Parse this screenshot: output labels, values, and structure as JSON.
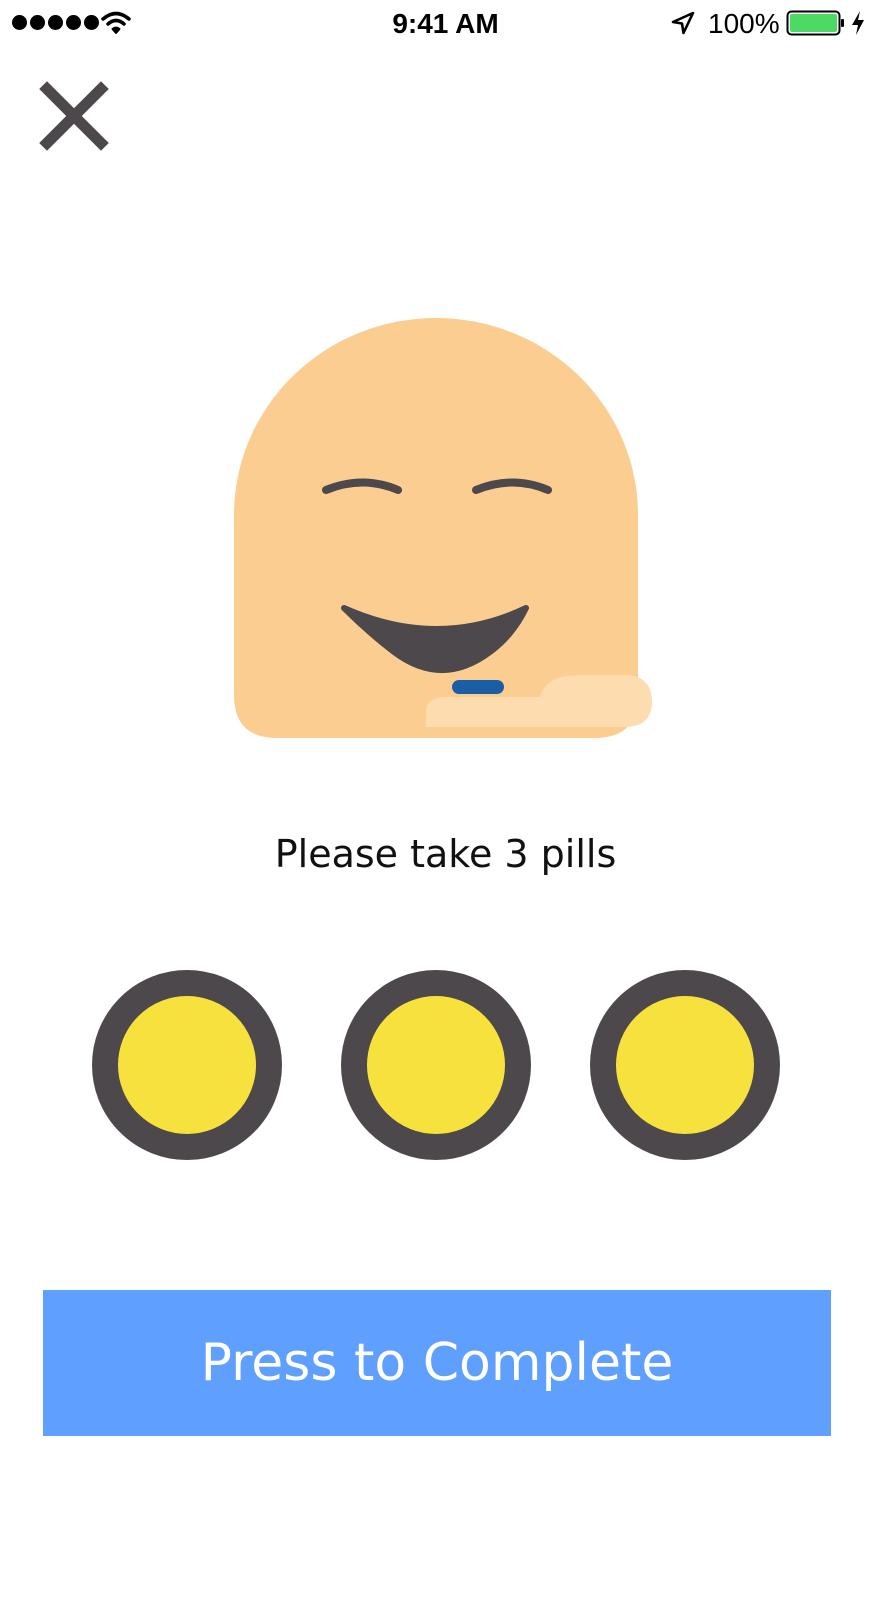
{
  "status_bar": {
    "time": "9:41 AM",
    "battery_percent": "100%",
    "signal_bars": 5,
    "icons": [
      "signal-dots",
      "wifi-icon",
      "location-arrow-icon",
      "battery-icon",
      "charging-bolt-icon"
    ]
  },
  "close": {
    "icon": "close-icon"
  },
  "illustration": {
    "icon": "smiling-face-with-pill-icon",
    "colors": {
      "face": "#fbcd90",
      "features": "#4c484b",
      "pill": "#1c5ea6",
      "hand": "#fddcb0"
    }
  },
  "instruction": {
    "text": "Please take 3 pills"
  },
  "pills": {
    "count": 3,
    "fill_color": "#f7e23d",
    "ring_color": "#4c484b"
  },
  "complete_button": {
    "label": "Press to Complete",
    "color": "#5f9ffd"
  }
}
